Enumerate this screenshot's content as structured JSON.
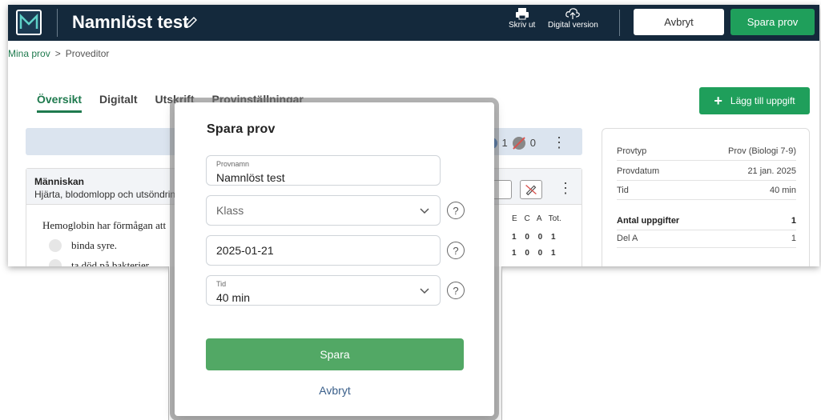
{
  "app": {
    "title": "Namnlöst test",
    "tools": [
      {
        "label": "Skriv ut",
        "icon": "printer-icon"
      },
      {
        "label": "Digital version",
        "icon": "cloud-upload-icon"
      }
    ],
    "cancel_label": "Avbryt",
    "save_label": "Spara prov"
  },
  "breadcrumb": {
    "parent": "Mina prov",
    "separator": ">",
    "current": "Proveditor"
  },
  "tabs": [
    {
      "label": "Översikt",
      "active": true
    },
    {
      "label": "Digitalt",
      "active": false
    },
    {
      "label": "Utskrift",
      "active": false
    },
    {
      "label": "Provinställningar",
      "active": false
    }
  ],
  "add_task_label": "Lägg till uppgift",
  "summary": {
    "blue_count": "1",
    "grey_count": "0"
  },
  "task": {
    "title": "Människan",
    "subtitle": "Hjärta, blodomlopp och utsöndring",
    "question": "Hemoglobin har förmågan att",
    "options": [
      "binda syre.",
      "ta död på bakterier."
    ],
    "score_header": "E C A Tot.",
    "score_rows": [
      "1 0 0 1",
      "1 0 0 1"
    ]
  },
  "info": {
    "rows": [
      {
        "label": "Provtyp",
        "value": "Prov (Biologi 7-9)"
      },
      {
        "label": "Provdatum",
        "value": "21 jan. 2025"
      },
      {
        "label": "Tid",
        "value": "40 min"
      }
    ],
    "count_rows": [
      {
        "label": "Antal uppgifter",
        "value": "1"
      },
      {
        "label": "Del A",
        "value": "1"
      }
    ]
  },
  "modal": {
    "title": "Spara prov",
    "name_label": "Provnamn",
    "name_value": "Namnlöst test",
    "class_placeholder": "Klass",
    "date_value": "2025-01-21",
    "time_label": "Tid",
    "time_value": "40 min",
    "help_glyph": "?",
    "save_label": "Spara",
    "cancel_label": "Avbryt"
  },
  "colors": {
    "topbar": "#14293c",
    "primary_green": "#1f9f5b",
    "modal_green": "#52a865",
    "link_blue": "#3a5f8a"
  }
}
